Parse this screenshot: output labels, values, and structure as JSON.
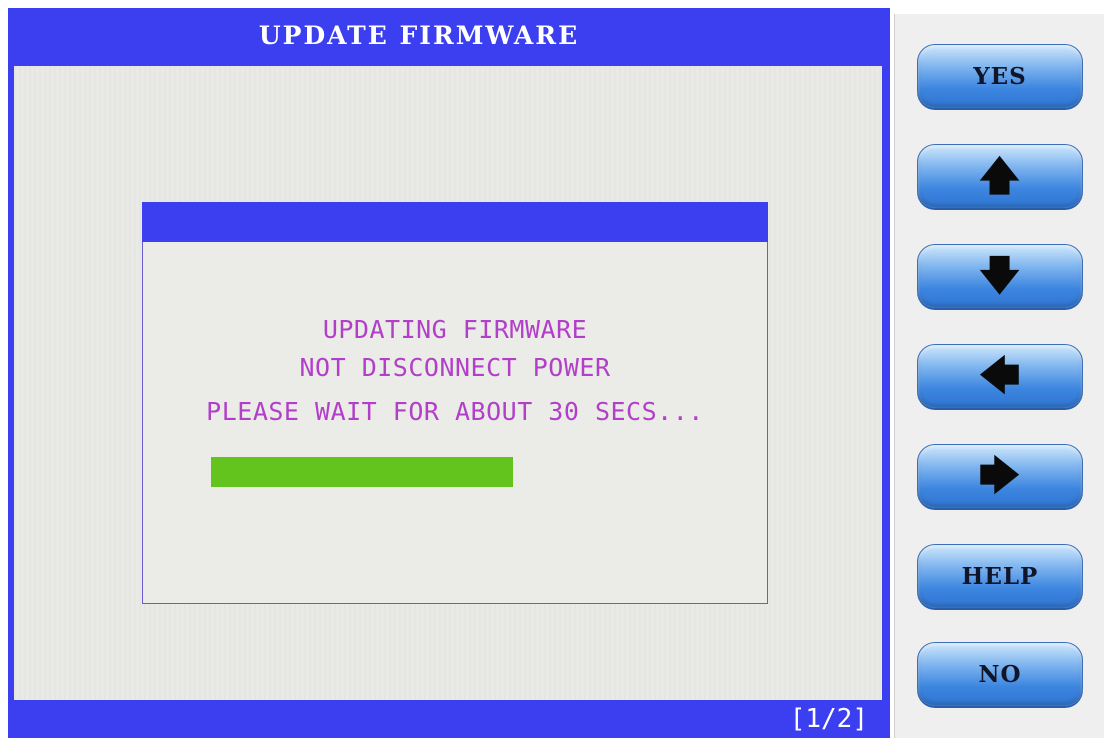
{
  "header": {
    "title": "UPDATE FIRMWARE"
  },
  "dialog": {
    "line1": "UPDATING FIRMWARE",
    "line2": "NOT DISCONNECT POWER",
    "line3": "PLEASE WAIT FOR ABOUT 30 SECS...",
    "progress_fraction": 0.63
  },
  "footer": {
    "page_indicator": "[1/2]"
  },
  "side_buttons": {
    "yes_label": "YES",
    "up_icon": "up-arrow-icon",
    "up_glyph": "🡅",
    "down_icon": "down-arrow-icon",
    "down_glyph": "🡇",
    "left_icon": "left-arrow-icon",
    "left_glyph": "🡄",
    "right_icon": "right-arrow-icon",
    "right_glyph": "🡆",
    "help_label": "HELP",
    "no_label": "NO"
  },
  "colors": {
    "bar_blue": "#3b3ff0",
    "dialog_text": "#b23fc8",
    "progress_green": "#63c41e",
    "button_blue": "#3d86e0"
  }
}
